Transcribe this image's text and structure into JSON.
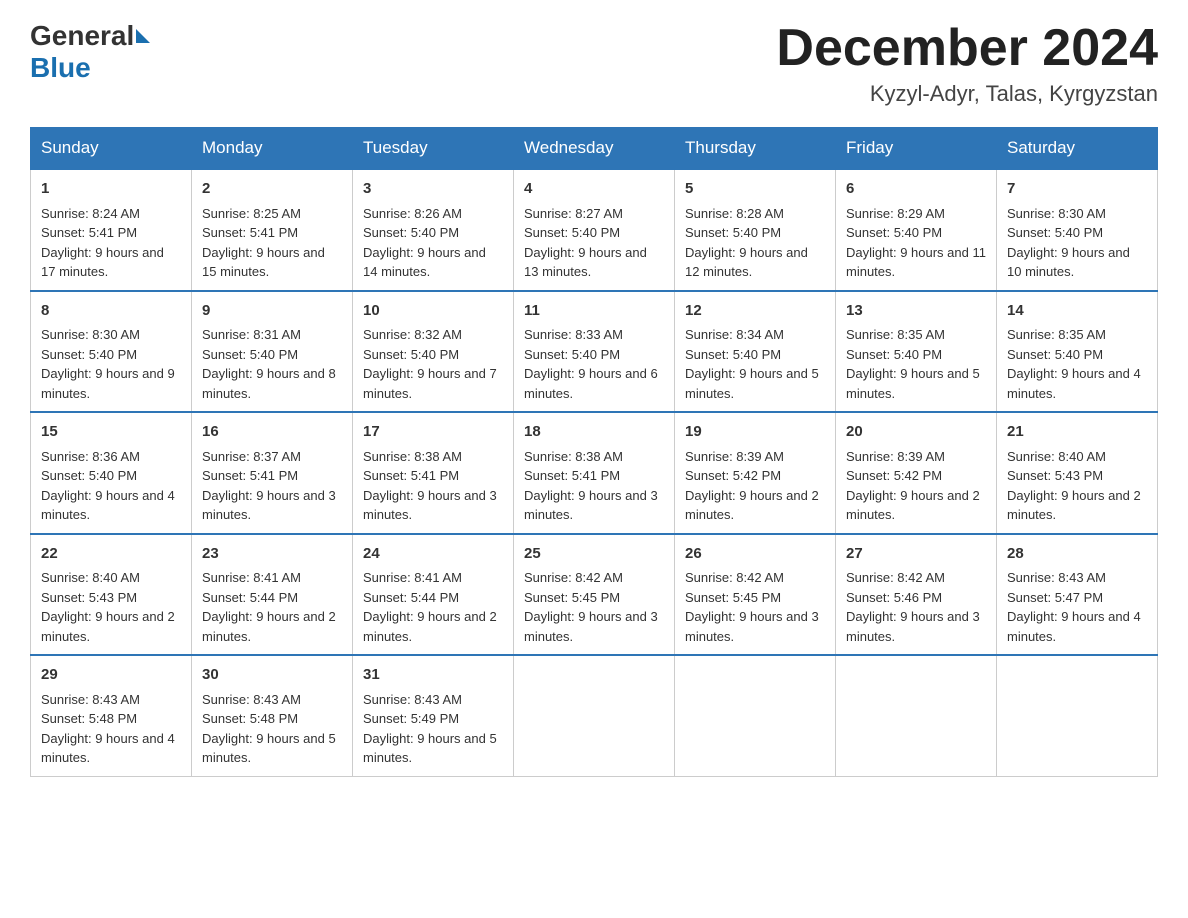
{
  "header": {
    "logo_general": "General",
    "logo_blue": "Blue",
    "month_title": "December 2024",
    "location": "Kyzyl-Adyr, Talas, Kyrgyzstan"
  },
  "days_of_week": [
    "Sunday",
    "Monday",
    "Tuesday",
    "Wednesday",
    "Thursday",
    "Friday",
    "Saturday"
  ],
  "weeks": [
    [
      {
        "day": "1",
        "sunrise": "Sunrise: 8:24 AM",
        "sunset": "Sunset: 5:41 PM",
        "daylight": "Daylight: 9 hours and 17 minutes."
      },
      {
        "day": "2",
        "sunrise": "Sunrise: 8:25 AM",
        "sunset": "Sunset: 5:41 PM",
        "daylight": "Daylight: 9 hours and 15 minutes."
      },
      {
        "day": "3",
        "sunrise": "Sunrise: 8:26 AM",
        "sunset": "Sunset: 5:40 PM",
        "daylight": "Daylight: 9 hours and 14 minutes."
      },
      {
        "day": "4",
        "sunrise": "Sunrise: 8:27 AM",
        "sunset": "Sunset: 5:40 PM",
        "daylight": "Daylight: 9 hours and 13 minutes."
      },
      {
        "day": "5",
        "sunrise": "Sunrise: 8:28 AM",
        "sunset": "Sunset: 5:40 PM",
        "daylight": "Daylight: 9 hours and 12 minutes."
      },
      {
        "day": "6",
        "sunrise": "Sunrise: 8:29 AM",
        "sunset": "Sunset: 5:40 PM",
        "daylight": "Daylight: 9 hours and 11 minutes."
      },
      {
        "day": "7",
        "sunrise": "Sunrise: 8:30 AM",
        "sunset": "Sunset: 5:40 PM",
        "daylight": "Daylight: 9 hours and 10 minutes."
      }
    ],
    [
      {
        "day": "8",
        "sunrise": "Sunrise: 8:30 AM",
        "sunset": "Sunset: 5:40 PM",
        "daylight": "Daylight: 9 hours and 9 minutes."
      },
      {
        "day": "9",
        "sunrise": "Sunrise: 8:31 AM",
        "sunset": "Sunset: 5:40 PM",
        "daylight": "Daylight: 9 hours and 8 minutes."
      },
      {
        "day": "10",
        "sunrise": "Sunrise: 8:32 AM",
        "sunset": "Sunset: 5:40 PM",
        "daylight": "Daylight: 9 hours and 7 minutes."
      },
      {
        "day": "11",
        "sunrise": "Sunrise: 8:33 AM",
        "sunset": "Sunset: 5:40 PM",
        "daylight": "Daylight: 9 hours and 6 minutes."
      },
      {
        "day": "12",
        "sunrise": "Sunrise: 8:34 AM",
        "sunset": "Sunset: 5:40 PM",
        "daylight": "Daylight: 9 hours and 5 minutes."
      },
      {
        "day": "13",
        "sunrise": "Sunrise: 8:35 AM",
        "sunset": "Sunset: 5:40 PM",
        "daylight": "Daylight: 9 hours and 5 minutes."
      },
      {
        "day": "14",
        "sunrise": "Sunrise: 8:35 AM",
        "sunset": "Sunset: 5:40 PM",
        "daylight": "Daylight: 9 hours and 4 minutes."
      }
    ],
    [
      {
        "day": "15",
        "sunrise": "Sunrise: 8:36 AM",
        "sunset": "Sunset: 5:40 PM",
        "daylight": "Daylight: 9 hours and 4 minutes."
      },
      {
        "day": "16",
        "sunrise": "Sunrise: 8:37 AM",
        "sunset": "Sunset: 5:41 PM",
        "daylight": "Daylight: 9 hours and 3 minutes."
      },
      {
        "day": "17",
        "sunrise": "Sunrise: 8:38 AM",
        "sunset": "Sunset: 5:41 PM",
        "daylight": "Daylight: 9 hours and 3 minutes."
      },
      {
        "day": "18",
        "sunrise": "Sunrise: 8:38 AM",
        "sunset": "Sunset: 5:41 PM",
        "daylight": "Daylight: 9 hours and 3 minutes."
      },
      {
        "day": "19",
        "sunrise": "Sunrise: 8:39 AM",
        "sunset": "Sunset: 5:42 PM",
        "daylight": "Daylight: 9 hours and 2 minutes."
      },
      {
        "day": "20",
        "sunrise": "Sunrise: 8:39 AM",
        "sunset": "Sunset: 5:42 PM",
        "daylight": "Daylight: 9 hours and 2 minutes."
      },
      {
        "day": "21",
        "sunrise": "Sunrise: 8:40 AM",
        "sunset": "Sunset: 5:43 PM",
        "daylight": "Daylight: 9 hours and 2 minutes."
      }
    ],
    [
      {
        "day": "22",
        "sunrise": "Sunrise: 8:40 AM",
        "sunset": "Sunset: 5:43 PM",
        "daylight": "Daylight: 9 hours and 2 minutes."
      },
      {
        "day": "23",
        "sunrise": "Sunrise: 8:41 AM",
        "sunset": "Sunset: 5:44 PM",
        "daylight": "Daylight: 9 hours and 2 minutes."
      },
      {
        "day": "24",
        "sunrise": "Sunrise: 8:41 AM",
        "sunset": "Sunset: 5:44 PM",
        "daylight": "Daylight: 9 hours and 2 minutes."
      },
      {
        "day": "25",
        "sunrise": "Sunrise: 8:42 AM",
        "sunset": "Sunset: 5:45 PM",
        "daylight": "Daylight: 9 hours and 3 minutes."
      },
      {
        "day": "26",
        "sunrise": "Sunrise: 8:42 AM",
        "sunset": "Sunset: 5:45 PM",
        "daylight": "Daylight: 9 hours and 3 minutes."
      },
      {
        "day": "27",
        "sunrise": "Sunrise: 8:42 AM",
        "sunset": "Sunset: 5:46 PM",
        "daylight": "Daylight: 9 hours and 3 minutes."
      },
      {
        "day": "28",
        "sunrise": "Sunrise: 8:43 AM",
        "sunset": "Sunset: 5:47 PM",
        "daylight": "Daylight: 9 hours and 4 minutes."
      }
    ],
    [
      {
        "day": "29",
        "sunrise": "Sunrise: 8:43 AM",
        "sunset": "Sunset: 5:48 PM",
        "daylight": "Daylight: 9 hours and 4 minutes."
      },
      {
        "day": "30",
        "sunrise": "Sunrise: 8:43 AM",
        "sunset": "Sunset: 5:48 PM",
        "daylight": "Daylight: 9 hours and 5 minutes."
      },
      {
        "day": "31",
        "sunrise": "Sunrise: 8:43 AM",
        "sunset": "Sunset: 5:49 PM",
        "daylight": "Daylight: 9 hours and 5 minutes."
      },
      null,
      null,
      null,
      null
    ]
  ]
}
